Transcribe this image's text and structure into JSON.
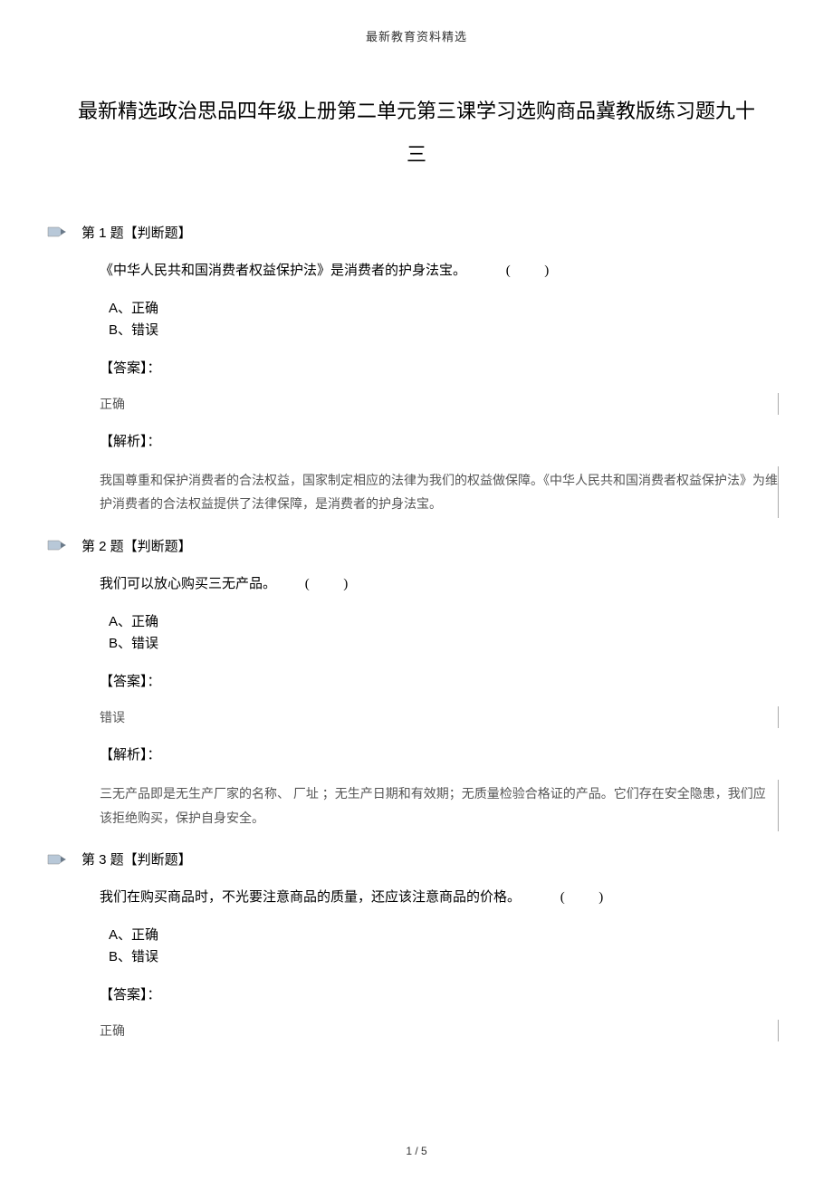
{
  "header": "最新教育资料精选",
  "title": "最新精选政治思品四年级上册第二单元第三课学习选购商品冀教版练习题九十三",
  "questions": [
    {
      "number": "第 1 题【判断题】",
      "stem": "《中华人民共和国消费者权益保护法》是消费者的护身法宝。",
      "option_a": "A、正确",
      "option_b": "B、错误",
      "answer_label": "【答案】：",
      "answer": "正确",
      "analysis_label": "【解析】：",
      "analysis": "我国尊重和保护消费者的合法权益，国家制定相应的法律为我们的权益做保障。《中华人民共和国消费者权益保护法》为维护消费者的合法权益提供了法律保障，是消费者的护身法宝。"
    },
    {
      "number": "第 2 题【判断题】",
      "stem": "我们可以放心购买三无产品。",
      "option_a": "A、正确",
      "option_b": "B、错误",
      "answer_label": "【答案】：",
      "answer": "错误",
      "analysis_label": "【解析】：",
      "analysis": "三无产品即是无生产厂家的名称、 厂址 ；无生产日期和有效期；无质量检验合格证的产品。它们存在安全隐患，我们应该拒绝购买，保护自身安全。"
    },
    {
      "number": "第 3 题【判断题】",
      "stem": "我们在购买商品时，不光要注意商品的质量，还应该注意商品的价格。",
      "option_a": "A、正确",
      "option_b": "B、错误",
      "answer_label": "【答案】：",
      "answer": "正确",
      "analysis_label": "",
      "analysis": ""
    }
  ],
  "footer": "1 / 5"
}
